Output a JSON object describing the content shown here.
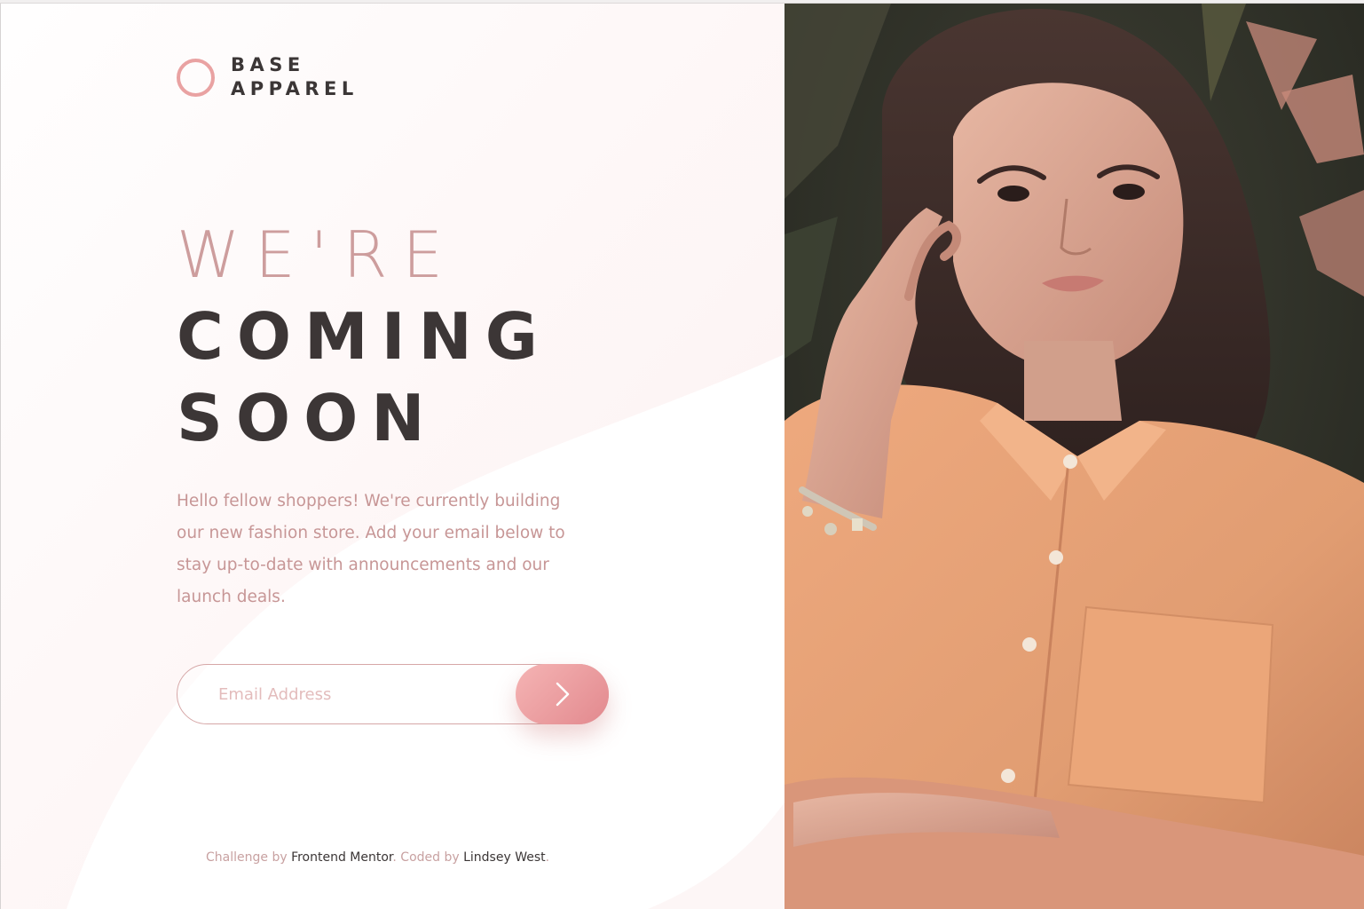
{
  "brand": {
    "line1": "BASE",
    "line2": "APPAREL"
  },
  "hero": {
    "light_line": "WE'RE",
    "bold_line1": "COMING",
    "bold_line2": "SOON"
  },
  "intro": "Hello fellow shoppers! We're currently building our new fashion store. Add your email below to stay up-to-date with announcements and our launch deals.",
  "form": {
    "email_placeholder": "Email Address",
    "submit_icon": "arrow-right-icon"
  },
  "footer": {
    "prefix": "Challenge by",
    "link1": "Frontend Mentor",
    "middle": ". Coded by",
    "link2": "Lindsey West",
    "suffix": "."
  },
  "colors": {
    "accent": "#e9a2a2",
    "text_dark": "#3c3636",
    "text_pink": "#c79696",
    "button_start": "#f5b4b4",
    "button_end": "#e2898e",
    "shirt": "#e8a477"
  },
  "hero_image": {
    "icon": "hero-photo"
  }
}
